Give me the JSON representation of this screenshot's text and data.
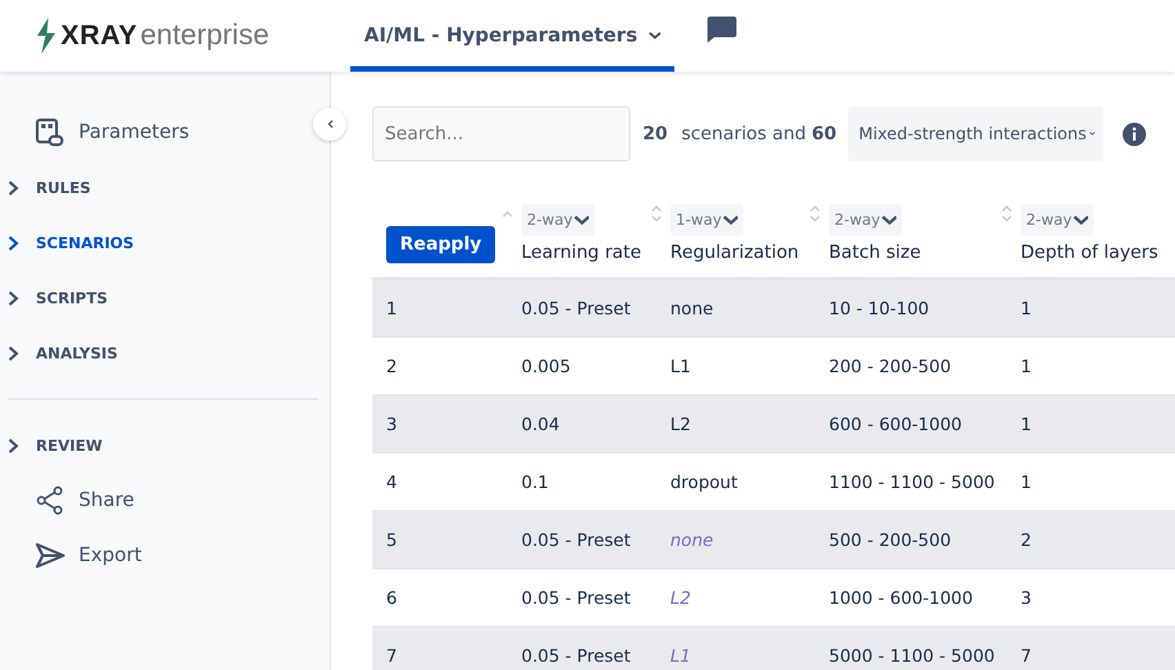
{
  "header": {
    "logo_bold": "XRAY",
    "logo_light": "enterprise",
    "tabs": [
      {
        "label": "AI/ML - Hyperparameters",
        "selected": true
      }
    ]
  },
  "sidebar": {
    "items": [
      {
        "kind": "parameters",
        "label": "Parameters"
      },
      {
        "kind": "section",
        "label": "RULES",
        "selected": false
      },
      {
        "kind": "section",
        "label": "SCENARIOS",
        "selected": true
      },
      {
        "kind": "section",
        "label": "SCRIPTS",
        "selected": false
      },
      {
        "kind": "section",
        "label": "ANALYSIS",
        "selected": false
      },
      {
        "kind": "divider"
      },
      {
        "kind": "section",
        "label": "REVIEW",
        "selected": false
      },
      {
        "kind": "share",
        "label": "Share"
      },
      {
        "kind": "export",
        "label": "Export"
      }
    ]
  },
  "toolbar": {
    "search": {
      "placeholder": "Search..."
    },
    "scenario_count": "20",
    "summary_text": "scenarios and",
    "interaction_count": "60",
    "strategy": "Mixed-strength interactions"
  },
  "table": {
    "reapply_button": "Reapply",
    "columns": [
      {
        "label": "Learning rate",
        "strength": "2-way"
      },
      {
        "label": "Regularization",
        "strength": "1-way"
      },
      {
        "label": "Batch size",
        "strength": "2-way"
      },
      {
        "label": "Depth of layers",
        "strength": "2-way"
      }
    ],
    "rows": [
      {
        "number": "1",
        "cells": [
          {
            "text": "0.05 - Preset",
            "derived": false
          },
          {
            "text": "none",
            "derived": false
          },
          {
            "text": "10 - 10-100",
            "derived": false
          },
          {
            "text": "1",
            "derived": false
          }
        ]
      },
      {
        "number": "2",
        "cells": [
          {
            "text": "0.005",
            "derived": false
          },
          {
            "text": "L1",
            "derived": false
          },
          {
            "text": "200 - 200-500",
            "derived": false
          },
          {
            "text": "1",
            "derived": false
          }
        ]
      },
      {
        "number": "3",
        "cells": [
          {
            "text": "0.04",
            "derived": false
          },
          {
            "text": "L2",
            "derived": false
          },
          {
            "text": "600 - 600-1000",
            "derived": false
          },
          {
            "text": "1",
            "derived": false
          }
        ]
      },
      {
        "number": "4",
        "cells": [
          {
            "text": "0.1",
            "derived": false
          },
          {
            "text": "dropout",
            "derived": false
          },
          {
            "text": "1100 - 1100 - 5000",
            "derived": false
          },
          {
            "text": "1",
            "derived": false
          }
        ]
      },
      {
        "number": "5",
        "cells": [
          {
            "text": "0.05 - Preset",
            "derived": false
          },
          {
            "text": "none",
            "derived": true
          },
          {
            "text": "500 - 200-500",
            "derived": false
          },
          {
            "text": "2",
            "derived": false
          }
        ]
      },
      {
        "number": "6",
        "cells": [
          {
            "text": "0.05 - Preset",
            "derived": false
          },
          {
            "text": "L2",
            "derived": true
          },
          {
            "text": "1000 - 600-1000",
            "derived": false
          },
          {
            "text": "3",
            "derived": false
          }
        ]
      },
      {
        "number": "7",
        "cells": [
          {
            "text": "0.05 - Preset",
            "derived": false
          },
          {
            "text": "L1",
            "derived": true
          },
          {
            "text": "5000 - 1100 - 5000",
            "derived": false
          },
          {
            "text": "7",
            "derived": false
          }
        ]
      }
    ]
  }
}
